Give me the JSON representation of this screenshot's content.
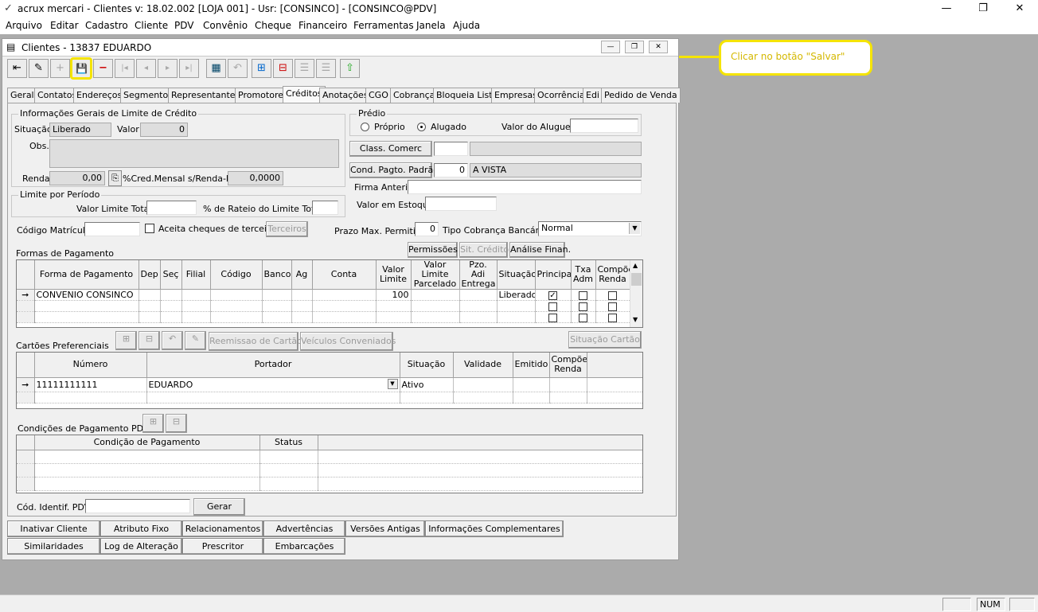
{
  "app": {
    "title": "acrux mercari - Clientes  v: 18.02.002  [LOJA 001] - Usr: [CONSINCO] - [CONSINCO@PDV]",
    "minimize": "—",
    "maximize": "❐",
    "close": "✕"
  },
  "menu": [
    "Arquivo",
    "Editar",
    "Cadastro",
    "Cliente",
    "PDV",
    "Convênio",
    "Cheque",
    "Financeiro",
    "Ferramentas",
    "Janela",
    "Ajuda"
  ],
  "child": {
    "title": "Clientes - 13837 EDUARDO"
  },
  "toolbar": {
    "icons": [
      "exit-icon",
      "edit-icon",
      "new-icon",
      "save-icon",
      "delete-icon",
      "first-icon",
      "prev-icon",
      "next-icon",
      "last-icon",
      "grid-icon",
      "undo-icon",
      "add-record-icon",
      "remove-record-icon",
      "list-icon",
      "list2-icon",
      "export-icon"
    ],
    "glyphs": [
      "⇤",
      "✎",
      "+",
      "💾",
      "−",
      "|◂",
      "◂",
      "▸",
      "▸|",
      "▦",
      "↶",
      "⊞",
      "⊟",
      "☰",
      "☰",
      "⇧"
    ]
  },
  "tabs": [
    "Geral",
    "Contatos",
    "Endereços",
    "Segmentos",
    "Representantes",
    "Promotores",
    "Créditos",
    "Anotações",
    "CGO",
    "Cobrança",
    "Bloqueia Lista",
    "Empresas",
    "Ocorrência",
    "Edi",
    "Pedido de Venda"
  ],
  "active_tab": "Créditos",
  "credit": {
    "group_title": "Informações Gerais de Limite de Crédito",
    "situacao_label": "Situação",
    "situacao_value": "Liberado",
    "valor_label": "Valor",
    "valor_value": "0",
    "obs_label": "Obs.",
    "renda_label": "Renda",
    "renda_value": "0,00",
    "cred_mensal_label": "%Cred.Mensal s/Renda-PF",
    "cred_mensal_value": "0,0000"
  },
  "limite": {
    "group_title": "Limite por Período",
    "valor_limite_label": "Valor Limite Total",
    "rateio_label": "% de Rateio do Limite Total"
  },
  "codigo_matricula_label": "Código Matrícula",
  "aceita_cheques_label": "Aceita cheques de terceiros",
  "terceiros_button": "Terceiros",
  "predio": {
    "group_title": "Prédio",
    "proprio": "Próprio",
    "alugado": "Alugado",
    "valor_aluguel_label": "Valor do Aluguel"
  },
  "class_comerc_button": "Class. Comerc",
  "cond_pagto_button": "Cond. Pagto. Padrão",
  "cond_pagto_code": "0",
  "cond_pagto_desc": "A VISTA",
  "firma_anterior_label": "Firma Anterior",
  "valor_estoque_label": "Valor em Estoque",
  "prazo_label": "Prazo Max. Permitido",
  "prazo_value": "0",
  "tipo_cobranca_label": "Tipo Cobrança Bancária",
  "tipo_cobranca_value": "Normal",
  "buttons_mid": {
    "permissoes": "Permissões",
    "sit_credito": "Sit. Crédito",
    "analise": "Análise Finan."
  },
  "formas": {
    "title": "Formas de Pagamento",
    "headers": [
      "Forma de Pagamento",
      "Dep",
      "Seç",
      "Filial",
      "Código",
      "Banco",
      "Ag",
      "Conta",
      "Valor Limite",
      "Valor Limite Parcelado",
      "Pzo. Adi Entrega",
      "Situação",
      "Principal",
      "Txa Adm",
      "Compõe Renda"
    ],
    "row": {
      "forma": "CONVENIO CONSINCO",
      "valor_limite": "100",
      "situacao": "Liberado"
    }
  },
  "cartoes": {
    "title": "Cartões Preferenciais",
    "remissao_button": "Reemissao de Cartão",
    "veiculos_button": "Veículos Conveniados",
    "situacao_button": "Situação Cartão",
    "headers": [
      "Número",
      "Portador",
      "Situação",
      "Validade",
      "Emitido",
      "Compõe Renda"
    ],
    "row": {
      "numero": "11111111111",
      "portador": "EDUARDO",
      "situacao": "Ativo"
    }
  },
  "condicoes": {
    "title": "Condições de Pagamento PDV",
    "headers": [
      "Condição de Pagamento",
      "Status"
    ]
  },
  "cod_identif_label": "Cód. Identif. PDV",
  "gerar_button": "Gerar",
  "bottom_row1": [
    "Inativar Cliente",
    "Atributo Fixo",
    "Relacionamentos",
    "Advertências",
    "Versões Antigas",
    "Informações Complementares"
  ],
  "bottom_row2": [
    "Similaridades",
    "Log de Alteração",
    "Prescritor",
    "Embarcações"
  ],
  "status": {
    "num": "NUM"
  },
  "callout": {
    "text": "Clicar no botão \"Salvar\""
  }
}
